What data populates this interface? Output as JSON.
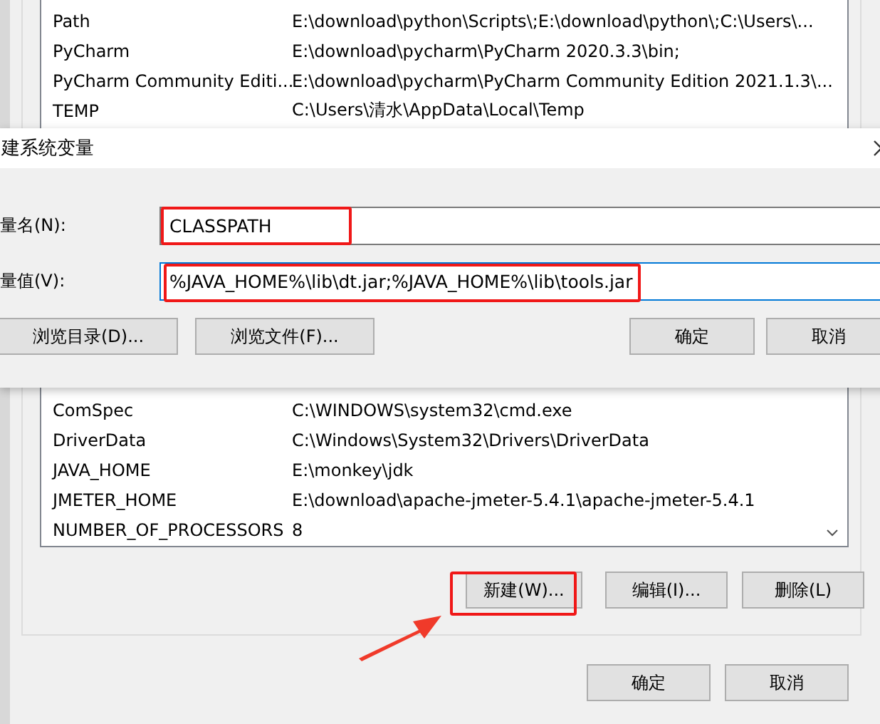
{
  "system_variables": {
    "rows_top": [
      {
        "name": "Path",
        "value": "E:\\download\\python\\Scripts\\;E:\\download\\python\\;C:\\Users\\..."
      },
      {
        "name": "PyCharm",
        "value": "E:\\download\\pycharm\\PyCharm 2020.3.3\\bin;"
      },
      {
        "name": "PyCharm Community Editi...",
        "value": "E:\\download\\pycharm\\PyCharm Community Edition 2021.1.3\\..."
      },
      {
        "name": "TEMP",
        "value": "C:\\Users\\清水\\AppData\\Local\\Temp"
      }
    ],
    "rows_bottom": [
      {
        "name": "ComSpec",
        "value": "C:\\WINDOWS\\system32\\cmd.exe"
      },
      {
        "name": "DriverData",
        "value": "C:\\Windows\\System32\\Drivers\\DriverData"
      },
      {
        "name": "JAVA_HOME",
        "value": "E:\\monkey\\jdk"
      },
      {
        "name": "JMETER_HOME",
        "value": "E:\\download\\apache-jmeter-5.4.1\\apache-jmeter-5.4.1"
      },
      {
        "name": "NUMBER_OF_PROCESSORS",
        "value": "8"
      }
    ],
    "buttons": [
      "新建(W)...",
      "编辑(I)...",
      "删除(L)"
    ]
  },
  "footer_buttons": [
    "确定",
    "取消"
  ],
  "dialog": {
    "title": "建系统变量",
    "name_label": "量名(N):",
    "name_value": "CLASSPATH",
    "value_label": "量值(V):",
    "value_value": "%JAVA_HOME%\\lib\\dt.jar;%JAVA_HOME%\\lib\\tools.jar",
    "left_buttons": [
      "浏览目录(D)...",
      "浏览文件(F)..."
    ],
    "right_buttons": [
      "确定",
      "取消"
    ]
  }
}
